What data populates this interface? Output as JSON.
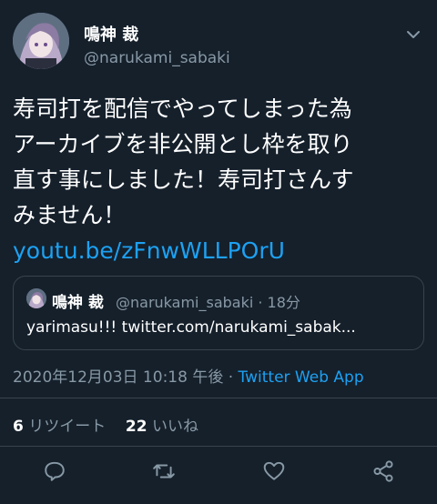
{
  "author": {
    "display_name": "鳴神 裁",
    "handle": "@narukami_sabaki"
  },
  "tweet": {
    "lines": [
      "寿司打を配信でやってしまった為",
      "アーカイブを非公開とし枠を取り",
      "直す事にしました！寿司打さんす",
      "みません！"
    ],
    "link": "youtu.be/zFnwWLLPOrU"
  },
  "quoted_tweet": {
    "display_name": "鳴神 裁",
    "handle_time": "@narukami_sabaki · 18分",
    "text": "yarimasu!!! twitter.com/narukami_sabak..."
  },
  "meta": {
    "timestamp": "2020年12月03日 10:18 午後 · ",
    "app": "Twitter Web App"
  },
  "stats": {
    "retweets_count": "6",
    "retweets_label": "リツイート",
    "likes_count": "22",
    "likes_label": "いいね"
  },
  "icons": {
    "caret": "chevron-down-icon",
    "reply": "reply-icon",
    "retweet": "retweet-icon",
    "like": "heart-icon",
    "share": "share-icon"
  },
  "colors": {
    "background": "#15202b",
    "accent": "#1da1f2",
    "secondary_text": "#8899a6",
    "border": "#38444d"
  }
}
